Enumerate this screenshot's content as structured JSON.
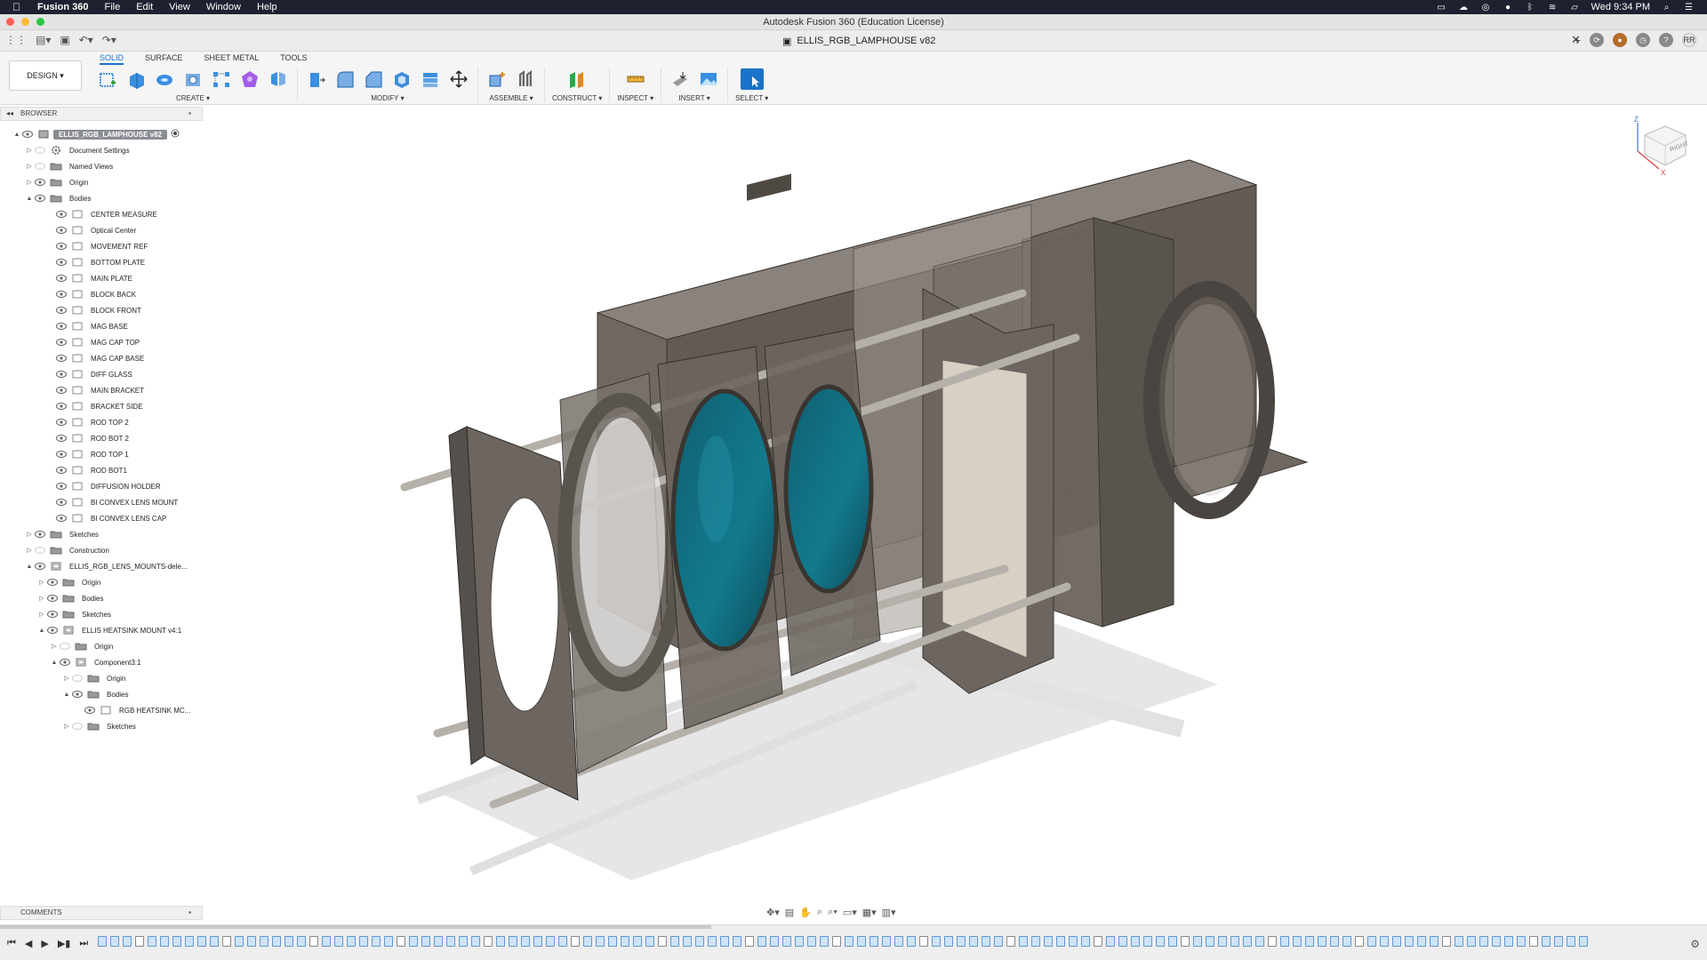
{
  "menubar": {
    "app_name": "Fusion 360",
    "menus": [
      "File",
      "Edit",
      "View",
      "Window",
      "Help"
    ],
    "clock": "Wed 9:34 PM"
  },
  "window": {
    "title": "Autodesk Fusion 360 (Education License)",
    "document_tab": "ELLIS_RGB_LAMPHOUSE v82",
    "user_initials": "RR"
  },
  "toolbar": {
    "workspace": "DESIGN ▾",
    "tabs": [
      "SOLID",
      "SURFACE",
      "SHEET METAL",
      "TOOLS"
    ],
    "groups": {
      "create": "CREATE ▾",
      "modify": "MODIFY ▾",
      "assemble": "ASSEMBLE ▾",
      "construct": "CONSTRUCT ▾",
      "inspect": "INSPECT ▾",
      "insert": "INSERT ▾",
      "select": "SELECT ▾"
    }
  },
  "browser": {
    "header": "BROWSER",
    "root": "ELLIS_RGB_LAMPHOUSE v82",
    "items": [
      "Document Settings",
      "Named Views",
      "Origin",
      "Bodies",
      "CENTER MEASURE",
      "Optical Center",
      "MOVEMENT REF",
      "BOTTOM PLATE",
      "MAIN PLATE",
      "BLOCK BACK",
      "BLOCK FRONT",
      "MAG BASE",
      "MAG CAP TOP",
      "MAG CAP BASE",
      "DIFF GLASS",
      "MAIN BRACKET",
      "BRACKET SIDE",
      "ROD TOP 2",
      "ROD BOT 2",
      "ROD TOP 1",
      "ROD BOT1",
      "DIFFUSION HOLDER",
      "BI CONVEX LENS MOUNT",
      "BI CONVEX LENS CAP",
      "Sketches",
      "Construction",
      "ELLIS_RGB_LENS_MOUNTS-dele...",
      "Origin",
      "Bodies",
      "Sketches",
      "ELLIS HEATSINK MOUNT v4:1",
      "Origin",
      "Component3:1",
      "Origin",
      "Bodies",
      "RGB HEATSINK MC...",
      "Sketches"
    ]
  },
  "comments": {
    "header": "COMMENTS"
  },
  "viewcube": {
    "face": "RIGHT",
    "axis_z": "Z",
    "axis_x": "X"
  },
  "colors": {
    "accent": "#1a73c9",
    "menubar": "#1e2130",
    "model_body": "#6f6862",
    "lens": "#0f6e80"
  }
}
